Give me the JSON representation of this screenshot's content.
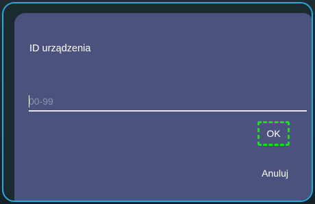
{
  "dialog": {
    "title": "ID urządzenia",
    "input": {
      "value": "",
      "placeholder": "00-99"
    },
    "buttons": {
      "ok_label": "OK",
      "cancel_label": "Anuluj"
    },
    "focused_button": "ok"
  },
  "colors": {
    "dialog_background": "#4b527d",
    "frame_border": "#29a9e1",
    "focus_highlight": "#1fdd1f",
    "text": "#ffffff"
  }
}
